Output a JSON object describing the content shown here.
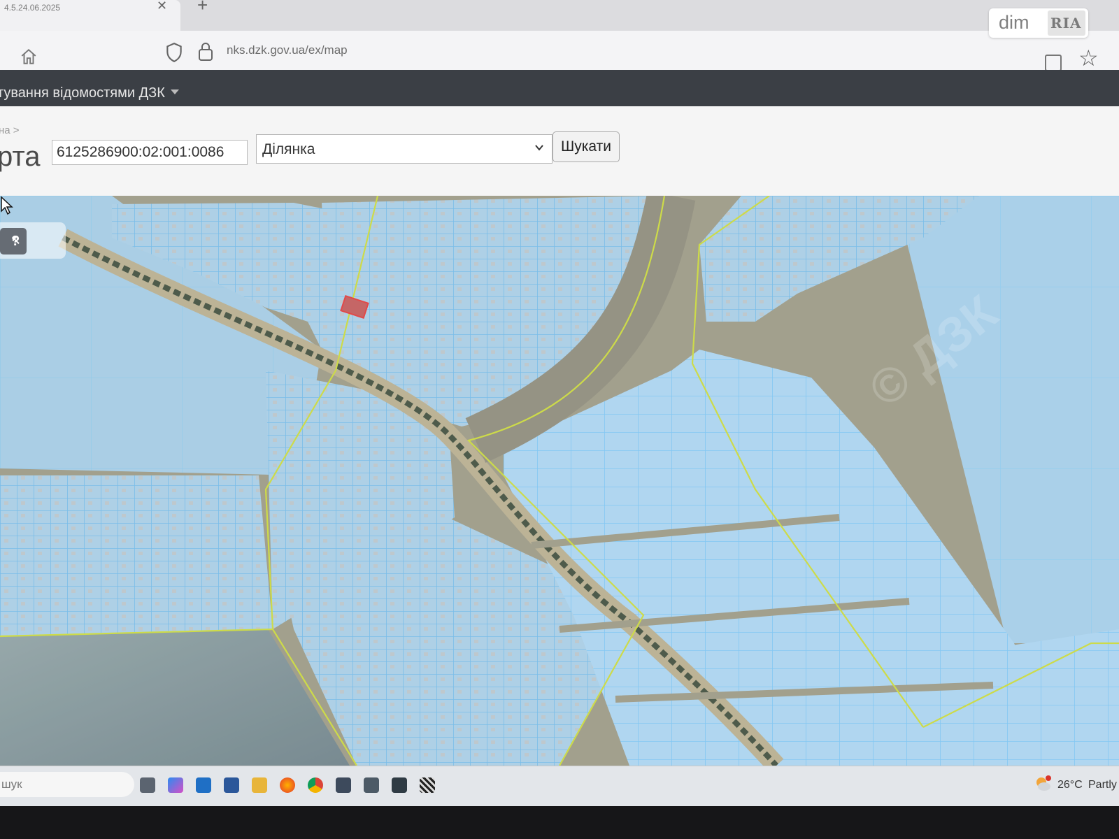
{
  "browser": {
    "tab_title": "4.5.24.06.2025",
    "url": "nks.dzk.gov.ua/ex/map"
  },
  "watermark": {
    "dim": "dim",
    "ria": "RIA"
  },
  "navbar": {
    "title_fragment": "тування відомостями ДЗК"
  },
  "search": {
    "breadcrumb": "на >",
    "page_title": "рта",
    "cadastral_number": "6125286900:02:001:0086",
    "type_selected": "Ділянка",
    "button_label": "Шукати"
  },
  "map": {
    "tool_label": "?",
    "watermark": "© ДЗК",
    "colors": {
      "parcel_fill": "#a9d3ee",
      "parcel_line": "#5fb1e8",
      "boundary": "#c9d83a",
      "ground": "#9d9a86",
      "selected": "#d83a3a"
    }
  },
  "taskbar": {
    "search_fragment": "шук",
    "apps": [
      "task-view-icon",
      "copilot-icon",
      "outlook-icon",
      "word-icon",
      "file-explorer-icon",
      "firefox-icon",
      "chrome-icon",
      "remote-desktop-icon",
      "notepad-icon",
      "excel-icon",
      "qr-app-icon"
    ],
    "weather_temp": "26°C",
    "weather_desc": "Partly s"
  }
}
